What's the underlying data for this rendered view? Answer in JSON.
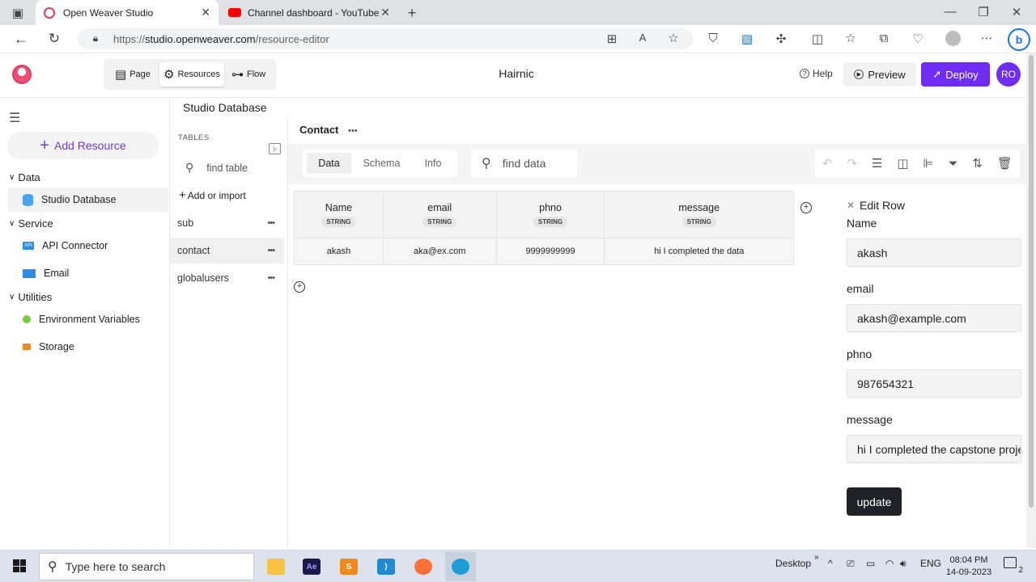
{
  "browser": {
    "tabs": [
      {
        "title": "Open Weaver Studio"
      },
      {
        "title": "Channel dashboard - YouTube St"
      }
    ],
    "url_prefix": "https://",
    "url_host": "studio.openweaver.com",
    "url_path": "/resource-editor"
  },
  "header": {
    "modes": [
      {
        "label": "Page"
      },
      {
        "label": "Resources"
      },
      {
        "label": "Flow"
      }
    ],
    "title": "Hairnic",
    "help_label": "Help",
    "preview_label": "Preview",
    "deploy_label": "Deploy",
    "avatar_initials": "RO"
  },
  "sidebar": {
    "add_resource_label": "Add Resource",
    "sections": [
      {
        "title": "Data",
        "items": [
          {
            "label": "Studio Database"
          }
        ]
      },
      {
        "title": "Service",
        "items": [
          {
            "label": "API Connector"
          },
          {
            "label": "Email"
          }
        ]
      },
      {
        "title": "Utilities",
        "items": [
          {
            "label": "Environment Variables"
          },
          {
            "label": "Storage"
          }
        ]
      }
    ]
  },
  "tables_panel": {
    "database_title": "Studio Database",
    "section_label": "TABLES",
    "search_placeholder": "find table",
    "add_label": "Add or import",
    "tables": [
      {
        "name": "sub"
      },
      {
        "name": "contact"
      },
      {
        "name": "globalusers"
      }
    ]
  },
  "main": {
    "table_title": "Contact",
    "tabs": [
      {
        "label": "Data"
      },
      {
        "label": "Schema"
      },
      {
        "label": "Info"
      }
    ],
    "search_placeholder": "find data",
    "columns": [
      {
        "name": "Name",
        "type": "STRING"
      },
      {
        "name": "email",
        "type": "STRING"
      },
      {
        "name": "phno",
        "type": "STRING"
      },
      {
        "name": "message",
        "type": "STRING"
      }
    ],
    "rows": [
      [
        "akash",
        "aka@ex.com",
        "9999999999",
        "hi I completed the data"
      ]
    ]
  },
  "edit_row": {
    "title": "Edit Row",
    "fields": [
      {
        "label": "Name",
        "value": "akash"
      },
      {
        "label": "email",
        "value": "akash@example.com"
      },
      {
        "label": "phno",
        "value": "987654321"
      },
      {
        "label": "message",
        "value": "hi I completed the capstone project"
      }
    ],
    "update_label": "update"
  },
  "taskbar": {
    "search_placeholder": "Type here to search",
    "desktop_label": "Desktop",
    "language": "ENG",
    "time": "08:04 PM",
    "date": "14-09-2023",
    "notification_count": "2"
  }
}
